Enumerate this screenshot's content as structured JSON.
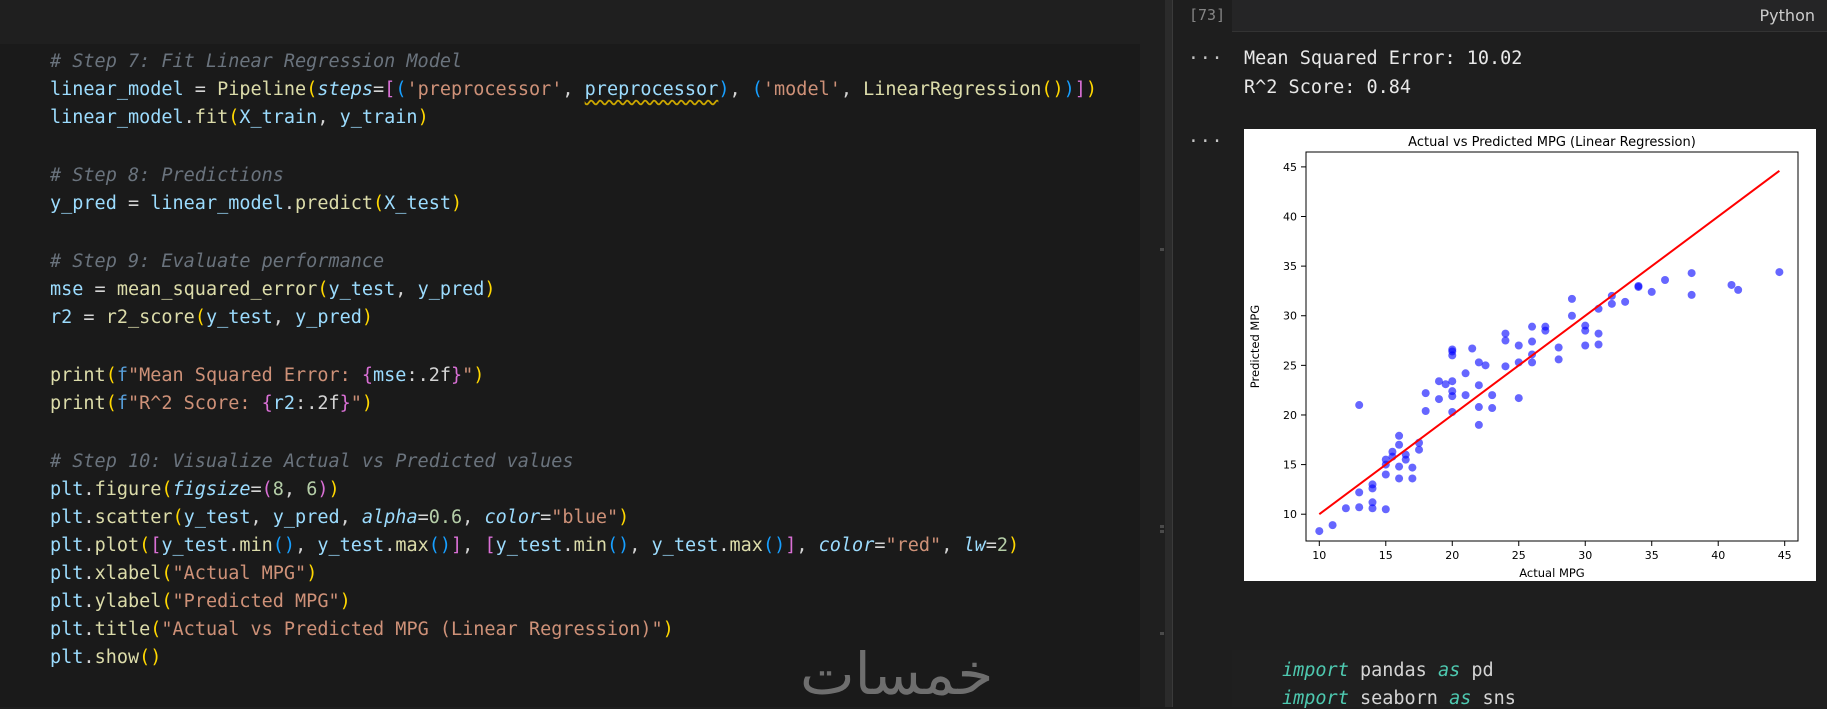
{
  "editor": {
    "lines": [
      {
        "top": 62,
        "html_kind": "comment",
        "text": "# Step 7: Fit Linear Regression Model"
      },
      {
        "top": 90,
        "html_kind": "l8"
      },
      {
        "top": 118,
        "html_kind": "l9"
      },
      {
        "top": 176,
        "html_kind": "comment",
        "text": "# Step 8: Predictions"
      },
      {
        "top": 204,
        "html_kind": "l12"
      },
      {
        "top": 262,
        "html_kind": "comment",
        "text": "# Step 9: Evaluate performance"
      },
      {
        "top": 290,
        "html_kind": "l15"
      },
      {
        "top": 318,
        "html_kind": "l16"
      },
      {
        "top": 376,
        "html_kind": "l18"
      },
      {
        "top": 404,
        "html_kind": "l19"
      },
      {
        "top": 462,
        "html_kind": "comment",
        "text": "# Step 10: Visualize Actual vs Predicted values"
      },
      {
        "top": 490,
        "html_kind": "l22"
      },
      {
        "top": 518,
        "html_kind": "l23"
      },
      {
        "top": 546,
        "html_kind": "l24"
      },
      {
        "top": 574,
        "html_kind": "l25"
      },
      {
        "top": 602,
        "html_kind": "l26"
      },
      {
        "top": 630,
        "html_kind": "l27"
      },
      {
        "top": 658,
        "html_kind": "l28"
      }
    ],
    "tokens": {
      "l8": [
        [
          "vr",
          "linear_model"
        ],
        [
          "pl",
          " = "
        ],
        [
          "fn",
          "Pipeline"
        ],
        [
          "bk1",
          "("
        ],
        [
          "it",
          "steps"
        ],
        [
          "pl",
          "="
        ],
        [
          "bk2",
          "["
        ],
        [
          "bk3",
          "("
        ],
        [
          "st",
          "'preprocessor'"
        ],
        [
          "pl",
          ", "
        ],
        [
          "sq",
          "preprocessor"
        ],
        [
          "bk3",
          ")"
        ],
        [
          "pl",
          ", "
        ],
        [
          "bk3",
          "("
        ],
        [
          "st",
          "'model'"
        ],
        [
          "pl",
          ", "
        ],
        [
          "fn",
          "LinearRegression"
        ],
        [
          "bk1",
          "()"
        ],
        [
          "bk3",
          ")"
        ],
        [
          "bk2",
          "]"
        ],
        [
          "bk1",
          ")"
        ]
      ],
      "l9": [
        [
          "vr",
          "linear_model"
        ],
        [
          "pl",
          "."
        ],
        [
          "fn",
          "fit"
        ],
        [
          "bk1",
          "("
        ],
        [
          "vr",
          "X_train"
        ],
        [
          "pl",
          ", "
        ],
        [
          "vr",
          "y_train"
        ],
        [
          "bk1",
          ")"
        ]
      ],
      "l12": [
        [
          "vr",
          "y_pred"
        ],
        [
          "pl",
          " = "
        ],
        [
          "vr",
          "linear_model"
        ],
        [
          "pl",
          "."
        ],
        [
          "fn",
          "predict"
        ],
        [
          "bk1",
          "("
        ],
        [
          "vr",
          "X_test"
        ],
        [
          "bk1",
          ")"
        ]
      ],
      "l15": [
        [
          "vr",
          "mse"
        ],
        [
          "pl",
          " = "
        ],
        [
          "fn",
          "mean_squared_error"
        ],
        [
          "bk1",
          "("
        ],
        [
          "vr",
          "y_test"
        ],
        [
          "pl",
          ", "
        ],
        [
          "vr",
          "y_pred"
        ],
        [
          "bk1",
          ")"
        ]
      ],
      "l16": [
        [
          "vr",
          "r2"
        ],
        [
          "pl",
          " = "
        ],
        [
          "fn",
          "r2_score"
        ],
        [
          "bk1",
          "("
        ],
        [
          "vr",
          "y_test"
        ],
        [
          "pl",
          ", "
        ],
        [
          "vr",
          "y_pred"
        ],
        [
          "bk1",
          ")"
        ]
      ],
      "l18": [
        [
          "fn",
          "print"
        ],
        [
          "bk1",
          "("
        ],
        [
          "fs",
          "f"
        ],
        [
          "st",
          "\"Mean Squared Error: "
        ],
        [
          "bk2",
          "{"
        ],
        [
          "vr",
          "mse"
        ],
        [
          "pl",
          ":.2f"
        ],
        [
          "bk2",
          "}"
        ],
        [
          "st",
          "\""
        ],
        [
          "bk1",
          ")"
        ]
      ],
      "l19": [
        [
          "fn",
          "print"
        ],
        [
          "bk1",
          "("
        ],
        [
          "fs",
          "f"
        ],
        [
          "st",
          "\"R^2 Score: "
        ],
        [
          "bk2",
          "{"
        ],
        [
          "vr",
          "r2"
        ],
        [
          "pl",
          ":.2f"
        ],
        [
          "bk2",
          "}"
        ],
        [
          "st",
          "\""
        ],
        [
          "bk1",
          ")"
        ]
      ],
      "l22": [
        [
          "vr",
          "plt"
        ],
        [
          "pl",
          "."
        ],
        [
          "fn",
          "figure"
        ],
        [
          "bk1",
          "("
        ],
        [
          "it",
          "figsize"
        ],
        [
          "pl",
          "="
        ],
        [
          "bk2",
          "("
        ],
        [
          "nm",
          "8"
        ],
        [
          "pl",
          ", "
        ],
        [
          "nm",
          "6"
        ],
        [
          "bk2",
          ")"
        ],
        [
          "bk1",
          ")"
        ]
      ],
      "l23": [
        [
          "vr",
          "plt"
        ],
        [
          "pl",
          "."
        ],
        [
          "fn",
          "scatter"
        ],
        [
          "bk1",
          "("
        ],
        [
          "vr",
          "y_test"
        ],
        [
          "pl",
          ", "
        ],
        [
          "vr",
          "y_pred"
        ],
        [
          "pl",
          ", "
        ],
        [
          "it",
          "alpha"
        ],
        [
          "pl",
          "="
        ],
        [
          "nm",
          "0.6"
        ],
        [
          "pl",
          ", "
        ],
        [
          "it",
          "color"
        ],
        [
          "pl",
          "="
        ],
        [
          "st",
          "\"blue\""
        ],
        [
          "bk1",
          ")"
        ]
      ],
      "l24": [
        [
          "vr",
          "plt"
        ],
        [
          "pl",
          "."
        ],
        [
          "fn",
          "plot"
        ],
        [
          "bk1",
          "("
        ],
        [
          "bk2",
          "["
        ],
        [
          "vr",
          "y_test"
        ],
        [
          "pl",
          "."
        ],
        [
          "fn",
          "min"
        ],
        [
          "bk3",
          "()"
        ],
        [
          "pl",
          ", "
        ],
        [
          "vr",
          "y_test"
        ],
        [
          "pl",
          "."
        ],
        [
          "fn",
          "max"
        ],
        [
          "bk3",
          "()"
        ],
        [
          "bk2",
          "]"
        ],
        [
          "pl",
          ", "
        ],
        [
          "bk2",
          "["
        ],
        [
          "vr",
          "y_test"
        ],
        [
          "pl",
          "."
        ],
        [
          "fn",
          "min"
        ],
        [
          "bk3",
          "()"
        ],
        [
          "pl",
          ", "
        ],
        [
          "vr",
          "y_test"
        ],
        [
          "pl",
          "."
        ],
        [
          "fn",
          "max"
        ],
        [
          "bk3",
          "()"
        ],
        [
          "bk2",
          "]"
        ],
        [
          "pl",
          ", "
        ],
        [
          "it",
          "color"
        ],
        [
          "pl",
          "="
        ],
        [
          "st",
          "\"red\""
        ],
        [
          "pl",
          ", "
        ],
        [
          "it",
          "lw"
        ],
        [
          "pl",
          "="
        ],
        [
          "nm",
          "2"
        ],
        [
          "bk1",
          ")"
        ]
      ],
      "l25": [
        [
          "vr",
          "plt"
        ],
        [
          "pl",
          "."
        ],
        [
          "fn",
          "xlabel"
        ],
        [
          "bk1",
          "("
        ],
        [
          "st",
          "\"Actual MPG\""
        ],
        [
          "bk1",
          ")"
        ]
      ],
      "l26": [
        [
          "vr",
          "plt"
        ],
        [
          "pl",
          "."
        ],
        [
          "fn",
          "ylabel"
        ],
        [
          "bk1",
          "("
        ],
        [
          "st",
          "\"Predicted MPG\""
        ],
        [
          "bk1",
          ")"
        ]
      ],
      "l27": [
        [
          "vr",
          "plt"
        ],
        [
          "pl",
          "."
        ],
        [
          "fn",
          "title"
        ],
        [
          "bk1",
          "("
        ],
        [
          "st",
          "\"Actual vs Predicted MPG (Linear Regression)\""
        ],
        [
          "bk1",
          ")"
        ]
      ],
      "l28": [
        [
          "vr",
          "plt"
        ],
        [
          "pl",
          "."
        ],
        [
          "fn",
          "show"
        ],
        [
          "bk1",
          "()"
        ]
      ]
    }
  },
  "watermark": "خمسات",
  "output": {
    "exec_count": "[73]",
    "language": "Python",
    "mse_line": "Mean Squared Error: 10.02",
    "r2_line": "R^2 Score: 0.84",
    "more_dots": "···"
  },
  "next_cell": {
    "line1": {
      "kw": "import",
      "mod": " pandas ",
      "as": "as",
      "alias": " pd"
    },
    "line2": {
      "kw": "import",
      "mod": " seaborn ",
      "as": "as",
      "alias": " sns"
    }
  },
  "chart_data": {
    "type": "scatter",
    "title": "Actual vs Predicted MPG (Linear Regression)",
    "xlabel": "Actual MPG",
    "ylabel": "Predicted MPG",
    "xlim": [
      9,
      46
    ],
    "ylim": [
      7.3,
      46.5
    ],
    "xticks": [
      10,
      15,
      20,
      25,
      30,
      35,
      40,
      45
    ],
    "yticks": [
      10,
      15,
      20,
      25,
      30,
      35,
      40,
      45
    ],
    "colors": {
      "points": "#0000ff",
      "line": "#ff0000"
    },
    "series": [
      {
        "kind": "scatter",
        "x": [
          10,
          11,
          12,
          13,
          13,
          13,
          14,
          14,
          14,
          14,
          15,
          15,
          15,
          15,
          15.5,
          15.5,
          16,
          16,
          16,
          16,
          16.5,
          16.5,
          17,
          17,
          17.5,
          17.5,
          18,
          18,
          19,
          19,
          19.5,
          20,
          20,
          20,
          20,
          20,
          20,
          20,
          21,
          21,
          21.5,
          22,
          22,
          22,
          22,
          22.5,
          23,
          23,
          24,
          24,
          24,
          25,
          25,
          25,
          26,
          26,
          26,
          26,
          27,
          27,
          28,
          28,
          29,
          29,
          30,
          30,
          30,
          31,
          31,
          31,
          32,
          32,
          33,
          34,
          34,
          35,
          36,
          38,
          38,
          41,
          41.5,
          44.6
        ],
        "y": [
          8.3,
          8.9,
          10.6,
          10.7,
          12.2,
          21,
          10.6,
          11.2,
          12.6,
          13,
          10.5,
          14,
          15,
          15.5,
          15.8,
          16.3,
          13.6,
          14.8,
          17,
          17.9,
          15.5,
          16,
          13.6,
          14.7,
          16.5,
          17.2,
          20.4,
          22.2,
          21.6,
          23.4,
          23.1,
          20.3,
          21.9,
          22.4,
          23.4,
          26,
          26.4,
          26.6,
          22,
          24.2,
          26.7,
          19,
          20.8,
          23,
          25.3,
          25,
          20.7,
          22,
          27.5,
          28.2,
          24.9,
          21.7,
          25.3,
          27,
          25.3,
          26.1,
          27.4,
          28.9,
          28.5,
          28.9,
          25.6,
          26.8,
          30,
          31.7,
          28.5,
          29,
          27,
          27.1,
          28.2,
          30.7,
          31.2,
          32,
          31.4,
          32.9,
          33,
          32.4,
          33.6,
          32.1,
          34.3,
          33.1,
          32.6,
          34.4
        ]
      },
      {
        "kind": "line",
        "x": [
          10,
          44.6
        ],
        "y": [
          10,
          44.6
        ]
      }
    ]
  }
}
